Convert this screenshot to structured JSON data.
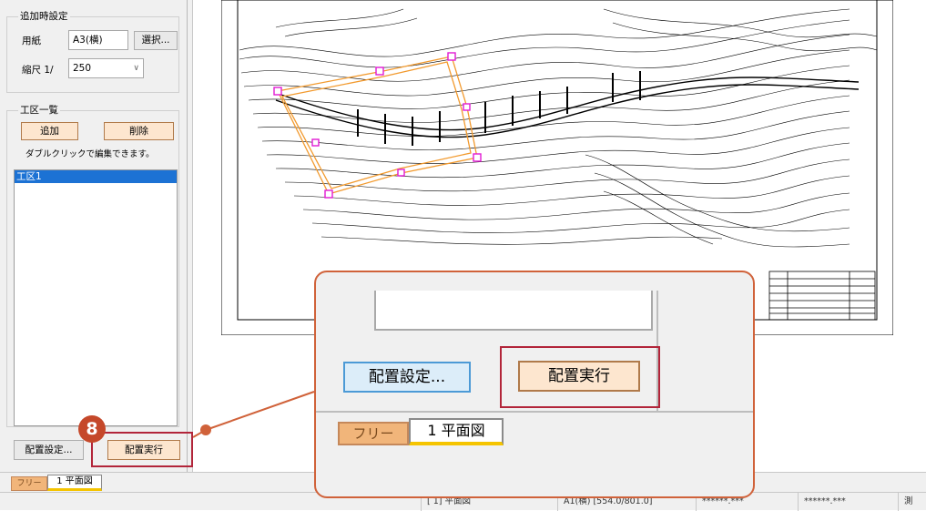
{
  "settings": {
    "group_title": "追加時設定",
    "paper_label": "用紙",
    "paper_value": "A3(横)",
    "select_button": "選択...",
    "scale_label": "縮尺  1/",
    "scale_value": "250"
  },
  "work_zones": {
    "group_title": "工区一覧",
    "add_button": "追加",
    "delete_button": "削除",
    "hint": "ダブルクリックで編集できます。",
    "items": [
      "工区1"
    ]
  },
  "actions": {
    "settings_button": "配置設定...",
    "execute_button": "配置実行"
  },
  "tabs": {
    "free": "フリー",
    "plan": "1  平面図"
  },
  "status_bar": {
    "view": "[ 1] 平面図",
    "paper": "A1(横) [554.0/801.0]",
    "coord_x": "******.***",
    "coord_y": "******.***",
    "mode": "測"
  },
  "step": {
    "number": "8"
  },
  "colors": {
    "accent": "#c5482a",
    "highlight": "#b2253a",
    "button_peach": "#fde6cf",
    "button_blue": "#dcedf9",
    "selection": "#1c72d4",
    "tab_underline": "#f5c400"
  }
}
